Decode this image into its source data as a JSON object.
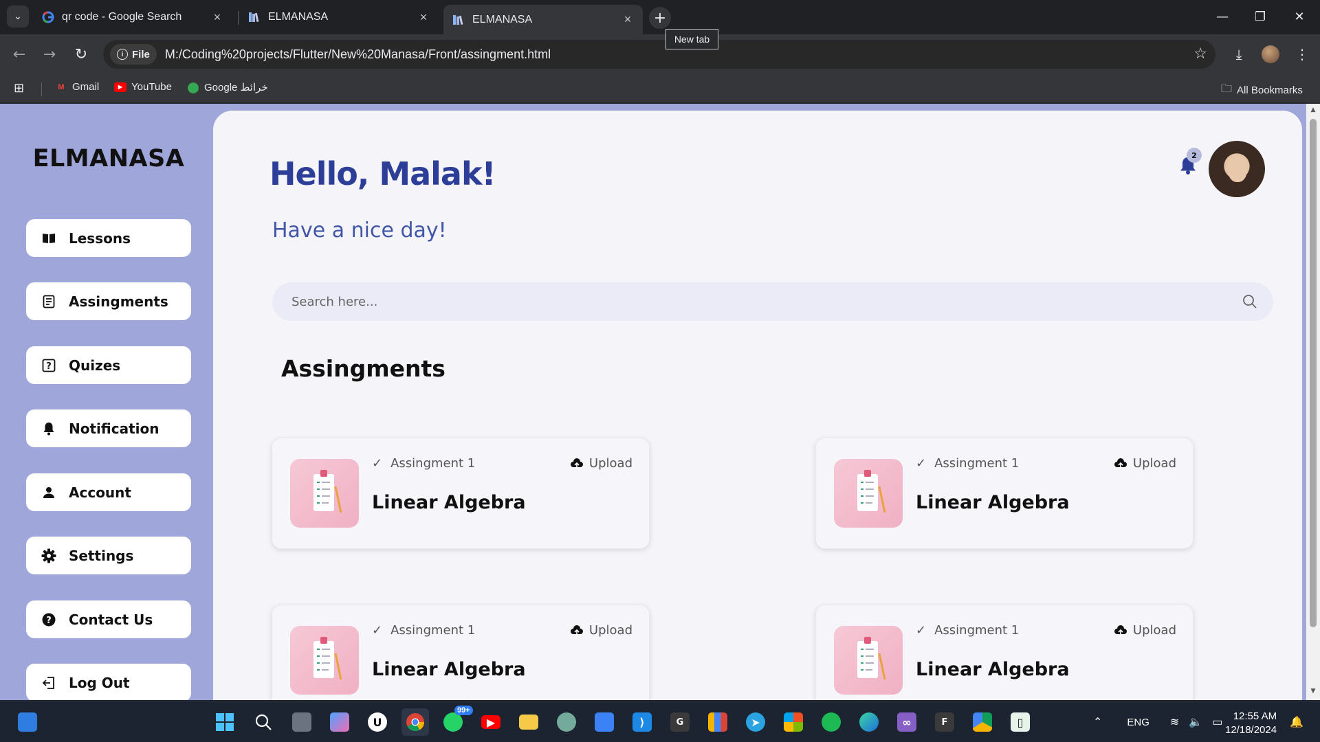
{
  "browser": {
    "tabs": [
      {
        "title": "qr code - Google Search",
        "favicon": "google-icon",
        "active": false
      },
      {
        "title": "ELMANASA",
        "favicon": "books-icon",
        "active": false
      },
      {
        "title": "ELMANASA",
        "favicon": "books-icon",
        "active": true
      }
    ],
    "new_tab_tooltip": "New tab",
    "site_chip": "File",
    "url": "M:/Coding%20projects/Flutter/New%20Manasa/Front/assingment.html",
    "bookmarks": [
      {
        "label": "Gmail",
        "icon": "gmail-icon"
      },
      {
        "label": "YouTube",
        "icon": "youtube-icon"
      },
      {
        "label": "Google خرائط",
        "icon": "maps-icon"
      }
    ],
    "all_bookmarks": "All Bookmarks"
  },
  "sidebar": {
    "logo": "ELMANASA",
    "items": [
      {
        "label": "Lessons",
        "icon": "book-icon"
      },
      {
        "label": "Assingments",
        "icon": "document-list-icon"
      },
      {
        "label": "Quizes",
        "icon": "question-box-icon"
      },
      {
        "label": "Notification",
        "icon": "bell-icon"
      },
      {
        "label": "Account",
        "icon": "person-icon"
      },
      {
        "label": "Settings",
        "icon": "gear-icon"
      },
      {
        "label": "Contact Us",
        "icon": "help-circle-icon"
      },
      {
        "label": "Log Out",
        "icon": "logout-icon"
      }
    ]
  },
  "header": {
    "greeting": "Hello, Malak!",
    "subtitle": "Have a nice day!",
    "notification_count": "2"
  },
  "search": {
    "placeholder": "Search here..."
  },
  "assignments": {
    "title": "Assingments",
    "cards": [
      {
        "label": "Assingment 1",
        "course": "Linear Algebra",
        "upload": "Upload"
      },
      {
        "label": "Assingment 1",
        "course": "Linear Algebra",
        "upload": "Upload"
      },
      {
        "label": "Assingment 1",
        "course": "Linear Algebra",
        "upload": "Upload"
      },
      {
        "label": "Assingment 1",
        "course": "Linear Algebra",
        "upload": "Upload"
      }
    ]
  },
  "taskbar": {
    "whatsapp_badge": "99+",
    "language": "ENG",
    "time": "12:55 AM",
    "date": "12/18/2024"
  },
  "colors": {
    "sidebar_bg": "#9fa6d9",
    "main_bg": "#f5f5f9",
    "greeting": "#2c3e98",
    "subtitle": "#4256a8"
  }
}
